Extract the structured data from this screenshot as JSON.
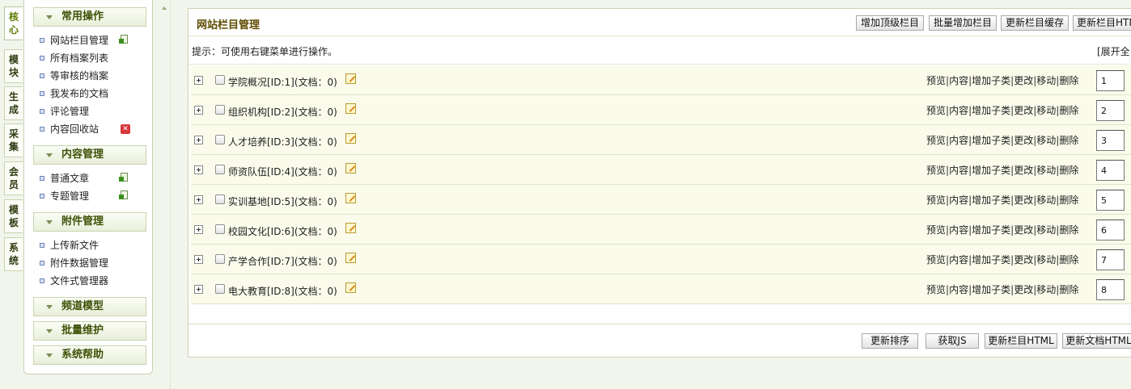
{
  "vtabs": [
    "核\n心",
    "模\n块",
    "生\n成",
    "采\n集",
    "会\n员",
    "模\n板",
    "系\n统"
  ],
  "menu": {
    "groups": [
      {
        "title": "常用操作",
        "items": [
          "网站栏目管理",
          "所有档案列表",
          "等审核的档案",
          "我发布的文档",
          "评论管理",
          "内容回收站"
        ]
      },
      {
        "title": "内容管理",
        "items": [
          "普通文章",
          "专题管理"
        ]
      },
      {
        "title": "附件管理",
        "items": [
          "上传新文件",
          "附件数据管理",
          "文件式管理器"
        ]
      }
    ],
    "collapsed": [
      "频道模型",
      "批量维护",
      "系统帮助"
    ]
  },
  "main": {
    "title": "网站栏目管理",
    "top_buttons": [
      "增加顶级栏目",
      "批量增加栏目",
      "更新栏目缓存",
      "更新栏目HTML"
    ],
    "tip": "提示：可使用右键菜单进行操作。",
    "expand_all": "[展开全",
    "actions": [
      "预览",
      "内容",
      "增加子类",
      "更改",
      "移动",
      "删除"
    ],
    "rows": [
      {
        "name": "学院概况[ID:1](文档：0)",
        "sort": "1"
      },
      {
        "name": "组织机构[ID:2](文档：0)",
        "sort": "2"
      },
      {
        "name": "人才培养[ID:3](文档：0)",
        "sort": "3"
      },
      {
        "name": "师资队伍[ID:4](文档：0)",
        "sort": "4"
      },
      {
        "name": "实训基地[ID:5](文档：0)",
        "sort": "5"
      },
      {
        "name": "校园文化[ID:6](文档：0)",
        "sort": "6"
      },
      {
        "name": "产学合作[ID:7](文档：0)",
        "sort": "7"
      },
      {
        "name": "电大教育[ID:8](文档：0)",
        "sort": "8"
      }
    ],
    "bottom_buttons": [
      "更新排序",
      "获取JS",
      "更新栏目HTML",
      "更新文档HTML"
    ]
  }
}
